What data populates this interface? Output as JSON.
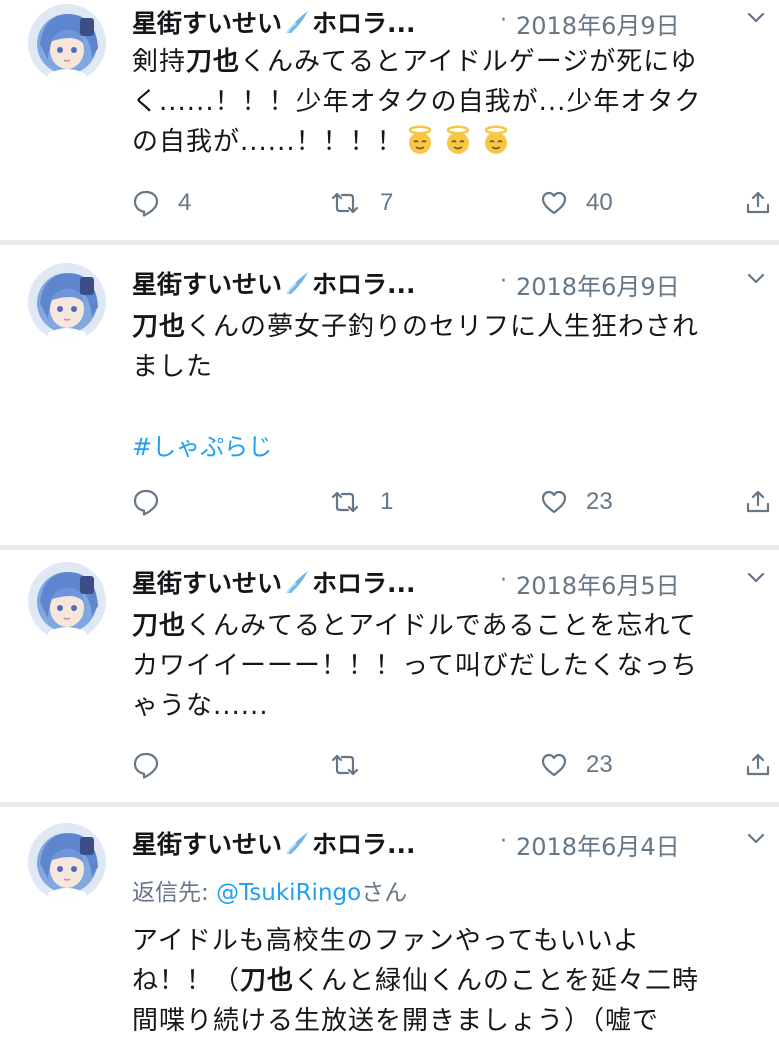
{
  "tweets": [
    {
      "display_name": "星街すいせい",
      "name_suffix": "ホロラ...",
      "dot": "·",
      "date": "2018年6月9日",
      "lines": [
        [
          {
            "t": "剣持"
          },
          {
            "t": "刀也",
            "b": true
          },
          {
            "t": "くんみてるとアイドルゲージが死にゆ"
          }
        ],
        [
          {
            "t": "く......！！！少年オタクの自我が...少年オタク"
          }
        ],
        [
          {
            "t": "の自我が......！！！！"
          }
        ]
      ],
      "emojis": [
        "angel-face-emoji",
        "angel-face-emoji",
        "angel-face-emoji"
      ],
      "reply_count": "4",
      "retweet_count": "7",
      "like_count": "40"
    },
    {
      "display_name": "星街すいせい",
      "name_suffix": "ホロラ...",
      "dot": "·",
      "date": "2018年6月9日",
      "lines": [
        [
          {
            "t": "刀也",
            "b": true
          },
          {
            "t": "くんの夢女子釣りのセリフに人生狂わされ"
          }
        ],
        [
          {
            "t": "ました"
          }
        ]
      ],
      "hashtag": "#しゃぷらじ",
      "reply_count": "",
      "retweet_count": "1",
      "like_count": "23"
    },
    {
      "display_name": "星街すいせい",
      "name_suffix": "ホロラ...",
      "dot": "·",
      "date": "2018年6月5日",
      "lines": [
        [
          {
            "t": "刀也",
            "b": true
          },
          {
            "t": "くんみてるとアイドルであることを忘れて"
          }
        ],
        [
          {
            "t": "カワイイーーー！！！って叫びだしたくなっち"
          }
        ],
        [
          {
            "t": "ゃうな......"
          }
        ]
      ],
      "reply_count": "",
      "retweet_count": "",
      "like_count": "23"
    },
    {
      "display_name": "星街すいせい",
      "name_suffix": "ホロラ...",
      "dot": "·",
      "date": "2018年6月4日",
      "reply_label": "返信先: ",
      "reply_handle": "@TsukiRingo",
      "reply_suffix": "さん",
      "lines": [
        [
          {
            "t": "アイドルも高校生のファンやってもいいよ"
          }
        ],
        [
          {
            "t": "ね！！（"
          },
          {
            "t": "刀也",
            "b": true
          },
          {
            "t": "くんと緑仙くんのことを延々二時"
          }
        ],
        [
          {
            "t": "間喋り続ける生放送を開きましょう）（嘘で"
          }
        ]
      ]
    }
  ],
  "colors": {
    "link": "#1da1f2",
    "meta": "#657786",
    "separator": "#e6ecf0",
    "text": "#14171a"
  },
  "icons": {
    "reply": "reply-icon",
    "retweet": "retweet-icon",
    "like": "like-icon",
    "share": "share-icon",
    "more": "chevron-down-icon",
    "name_emoji": "comet-emoji"
  }
}
